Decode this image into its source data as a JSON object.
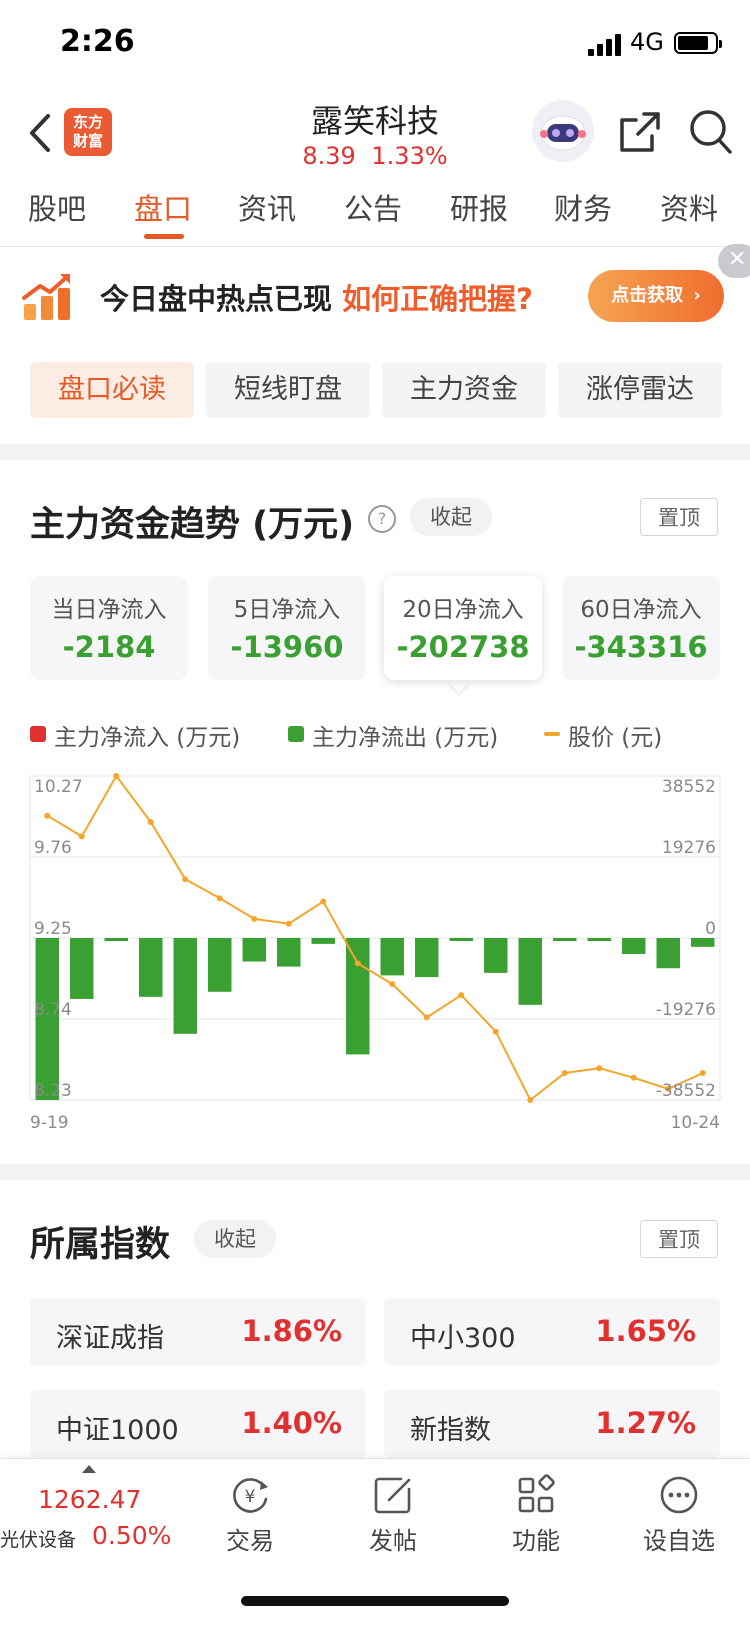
{
  "status_bar": {
    "time": "2:26",
    "network": "4G"
  },
  "header": {
    "logo_line1": "东方",
    "logo_line2": "财富",
    "stock_name": "露笑科技",
    "price": "8.39",
    "change_pct": "1.33%"
  },
  "tabs": [
    "股吧",
    "盘口",
    "资讯",
    "公告",
    "研报",
    "财务",
    "资料"
  ],
  "promo": {
    "text_main": "今日盘中热点已现",
    "text_highlight": "如何正确把握?",
    "button": "点击获取",
    "close": "✕"
  },
  "segments": [
    "盘口必读",
    "短线盯盘",
    "主力资金",
    "涨停雷达"
  ],
  "fund_trend": {
    "title": "主力资金趋势 (万元)",
    "help": "?",
    "collapse": "收起",
    "pin": "置顶",
    "cards": [
      {
        "label": "当日净流入",
        "value": "-2184"
      },
      {
        "label": "5日净流入",
        "value": "-13960"
      },
      {
        "label": "20日净流入",
        "value": "-202738"
      },
      {
        "label": "60日净流入",
        "value": "-343316"
      }
    ],
    "legend": {
      "inflow": "主力净流入 (万元)",
      "outflow": "主力净流出 (万元)",
      "price": "股价 (元)"
    }
  },
  "chart_data": {
    "type": "bar",
    "start_label": "9-19",
    "end_label": "10-24",
    "left_axis_ticks": [
      "10.27",
      "9.76",
      "9.25",
      "8.74",
      "8.23"
    ],
    "right_axis_ticks": [
      "38552",
      "19276",
      "0",
      "-19276",
      "-38552"
    ],
    "left_range": [
      8.23,
      10.27
    ],
    "right_range": [
      -38552,
      38552
    ],
    "net_flow": [
      -38552,
      -14500,
      -400,
      -14000,
      -22800,
      -12800,
      -5600,
      -6800,
      -1400,
      -27700,
      -8900,
      -9300,
      0,
      -8300,
      -15900,
      0,
      -300,
      -3800,
      -7200,
      -2100
    ],
    "price": [
      10.02,
      9.89,
      10.27,
      9.98,
      9.62,
      9.5,
      9.37,
      9.34,
      9.48,
      9.09,
      8.96,
      8.75,
      8.89,
      8.66,
      8.23,
      8.4,
      8.43,
      8.37,
      8.3,
      8.4
    ],
    "colors": {
      "outflow": "#3aa032",
      "inflow": "#e0312f",
      "price": "#f3a62c"
    }
  },
  "indices": {
    "title": "所属指数",
    "collapse": "收起",
    "pin": "置顶",
    "items": [
      {
        "name": "深证成指",
        "pct": "1.86%"
      },
      {
        "name": "中小300",
        "pct": "1.65%"
      },
      {
        "name": "中证1000",
        "pct": "1.40%"
      },
      {
        "name": "新指数",
        "pct": "1.27%"
      }
    ]
  },
  "bottom_bar": {
    "sector_value": "1262.47",
    "sector_name": "光伏设备",
    "sector_pct": "0.50%",
    "items": [
      "交易",
      "发帖",
      "功能",
      "设自选"
    ]
  }
}
